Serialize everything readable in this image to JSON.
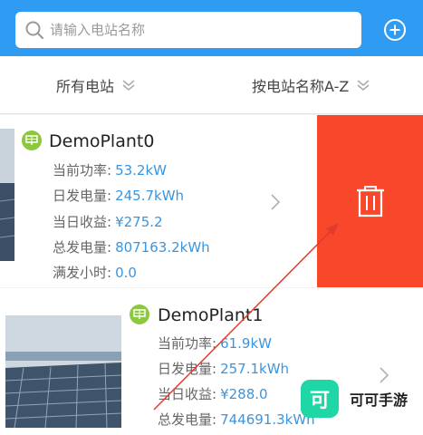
{
  "search": {
    "placeholder": "请输入电站名称"
  },
  "filters": {
    "plants_label": "所有电站",
    "sort_label": "按电站名称A-Z"
  },
  "plants": [
    {
      "name": "DemoPlant0",
      "rows": [
        {
          "label": "当前功率:",
          "value": "53.2kW"
        },
        {
          "label": "日发电量:",
          "value": "245.7kWh"
        },
        {
          "label": "当日收益:",
          "value": "¥275.2"
        },
        {
          "label": "总发电量:",
          "value": "807163.2kWh"
        },
        {
          "label": "满发小时:",
          "value": "0.0"
        }
      ]
    },
    {
      "name": "DemoPlant1",
      "rows": [
        {
          "label": "当前功率:",
          "value": "61.9kW"
        },
        {
          "label": "日发电量:",
          "value": "257.1kWh"
        },
        {
          "label": "当日收益:",
          "value": "¥288.0"
        },
        {
          "label": "总发电量:",
          "value": "744691.3kWh"
        }
      ]
    }
  ],
  "watermark": {
    "logo_text": "可",
    "text": "可可手游"
  },
  "colors": {
    "header": "#2f9bf2",
    "delete": "#f9472c",
    "value": "#3b95de",
    "plant_icon": "#8dc63f",
    "watermark": "#1fd6a6"
  }
}
